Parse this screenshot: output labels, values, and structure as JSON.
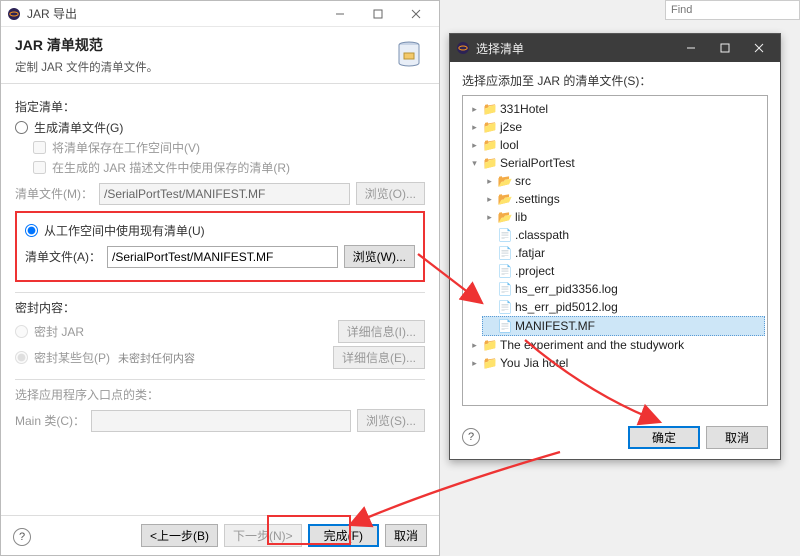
{
  "find": {
    "placeholder": "Find"
  },
  "jar_dialog": {
    "title": "JAR 导出",
    "heading": "JAR 清单规范",
    "subheading": "定制 JAR 文件的清单文件。",
    "specify_manifest_label": "指定清单：",
    "opt_generate": "生成清单文件(G)",
    "chk_save_workspace": "将清单保存在工作空间中(V)",
    "chk_reuse_saved": "在生成的 JAR 描述文件中使用保存的清单(R)",
    "manifest_file_m_label": "清单文件(M)：",
    "manifest_path_m": "/SerialPortTest/MANIFEST.MF",
    "browse_o": "浏览(O)...",
    "opt_use_existing": "从工作空间中使用现有清单(U)",
    "manifest_file_a_label": "清单文件(A)：",
    "manifest_path_a": "/SerialPortTest/MANIFEST.MF",
    "browse_w": "浏览(W)...",
    "seal_section": "密封内容：",
    "seal_jar": "密封 JAR",
    "seal_some": "密封某些包(P)",
    "not_sealed": "未密封任何内容",
    "detail_i": "详细信息(I)...",
    "detail_e": "详细信息(E)...",
    "entry_label": "选择应用程序入口点的类：",
    "main_class_label": "Main 类(C)：",
    "browse_s": "浏览(S)...",
    "back": "<上一步(B)",
    "next": "下一步(N)>",
    "finish": "完成(F)",
    "cancel": "取消"
  },
  "sel_dialog": {
    "title": "选择清单",
    "prompt": "选择应添加至 JAR 的清单文件(S)：",
    "ok": "确定",
    "cancel": "取消",
    "tree": {
      "n0": "331Hotel",
      "n1": "j2se",
      "n2": "lool",
      "n3": "SerialPortTest",
      "n3_0": "src",
      "n3_1": ".settings",
      "n3_2": "lib",
      "n3_3": ".classpath",
      "n3_4": ".fatjar",
      "n3_5": ".project",
      "n3_6": "hs_err_pid3356.log",
      "n3_7": "hs_err_pid5012.log",
      "n3_8": "MANIFEST.MF",
      "n4": "The experiment and the studywork",
      "n5": "You Jia hotel"
    }
  }
}
